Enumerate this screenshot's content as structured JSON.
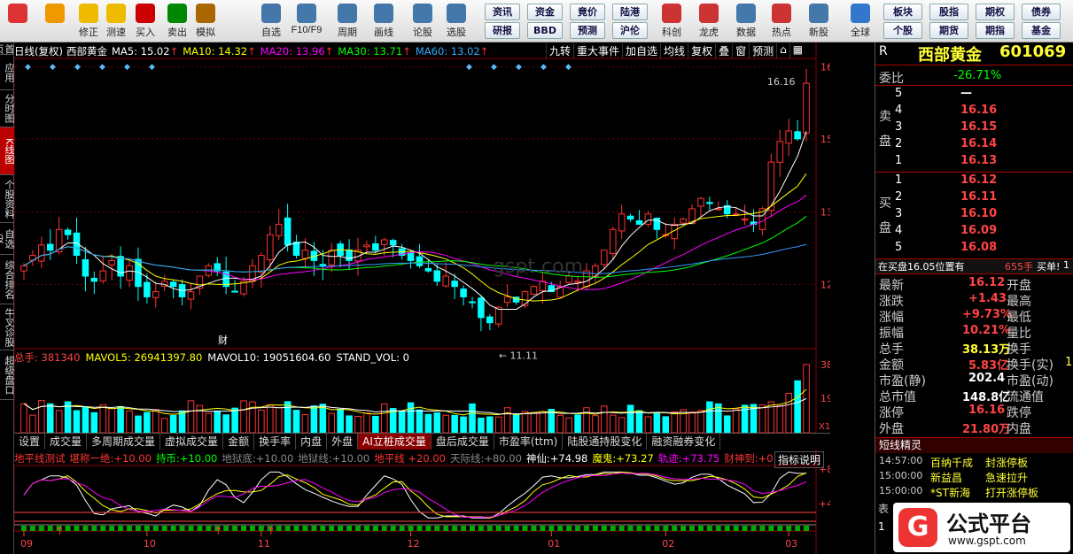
{
  "toolbar": {
    "left": [
      {
        "l": "",
        "c": "#d33"
      },
      {
        "l": "",
        "c": "#e90"
      },
      {
        "l": "修正",
        "c": "#eb0"
      },
      {
        "l": "测速",
        "c": "#eb0"
      },
      {
        "l": "买入",
        "c": "#c00"
      },
      {
        "l": "卖出",
        "c": "#080"
      },
      {
        "l": "模拟",
        "c": "#a60"
      },
      {
        "l": "自选",
        "c": "#47a"
      },
      {
        "l": "F10/F9",
        "c": "#47a"
      },
      {
        "l": "周期",
        "c": "#47a"
      },
      {
        "l": "画线",
        "c": "#47a"
      },
      {
        "l": "论股",
        "c": "#47a"
      },
      {
        "l": "选股",
        "c": "#47a"
      }
    ],
    "small": [
      [
        "资讯",
        "资金",
        "竟价",
        "陆港"
      ],
      [
        "研报",
        "BBD",
        "预测",
        "沪伦"
      ]
    ],
    "right": [
      {
        "l": "科创",
        "c": "#c33"
      },
      {
        "l": "龙虎",
        "c": "#c33"
      },
      {
        "l": "数据",
        "c": "#47a"
      },
      {
        "l": "热点",
        "c": "#c33"
      },
      {
        "l": "新股",
        "c": "#47a"
      },
      {
        "l": "全球",
        "c": "#37c"
      }
    ],
    "small2": [
      [
        "板块",
        "股指",
        "期权",
        "债券"
      ],
      [
        "个股",
        "期货",
        "期指",
        "基金"
      ]
    ]
  },
  "sidebar": [
    "首页",
    "应用",
    "分时图",
    "K线图",
    "个股资料",
    "自选股",
    "综合排名",
    "牛叉诊股",
    "超级盘口"
  ],
  "chart": {
    "period_label": "日线(复权)",
    "stock_name": "西部黄金",
    "ma": [
      {
        "k": "MA5",
        "v": "15.02",
        "c": "#fff"
      },
      {
        "k": "MA10",
        "v": "14.32",
        "c": "#ff0"
      },
      {
        "k": "MA20",
        "v": "13.96",
        "c": "#f0f"
      },
      {
        "k": "MA30",
        "v": "13.71",
        "c": "#0f0"
      },
      {
        "k": "MA60",
        "v": "13.02",
        "c": "#3af"
      }
    ],
    "buttons": [
      "九转",
      "重大事件",
      "加自选",
      "均线",
      "复权",
      "叠",
      "窗",
      "预测"
    ],
    "price_ticks": [
      "16.44",
      "15.05",
      "13.64",
      "12.24"
    ],
    "high_label": "16.16",
    "low_label": "11.11",
    "cai_label": "财",
    "vol_line": [
      {
        "k": "总手",
        "v": "381340",
        "c": "#f44"
      },
      {
        "k": "MAVOL5",
        "v": "26941397.80",
        "c": "#ff0"
      },
      {
        "k": "MAVOL10",
        "v": "19051604.60",
        "c": "#fff"
      },
      {
        "k": "STAND_VOL",
        "v": "0",
        "c": "#fff"
      }
    ],
    "vol_ticks": [
      "38134",
      "19321"
    ],
    "vol_unit": "X10",
    "tabs": [
      "设置",
      "成交量",
      "多周期成交量",
      "虚拟成交量",
      "金额",
      "换手率",
      "内盘",
      "外盘",
      "AI立桩成交量",
      "盘后成交量",
      "市盈率(ttm)",
      "陆股通持股变化",
      "融资融券变化"
    ],
    "active_tab": "AI立桩成交量",
    "ind_line": [
      {
        "t": "地平线测试",
        "c": "#f33"
      },
      {
        "t": "堪称一绝:+10.00",
        "c": "#f33"
      },
      {
        "t": "持币:+10.00",
        "c": "#0f0"
      },
      {
        "t": "地狱底:+10.00",
        "c": "#888"
      },
      {
        "t": "地狱线:+10.00",
        "c": "#888"
      },
      {
        "t": "地平线 +20.00",
        "c": "#f33"
      },
      {
        "t": "天际线:+80.00",
        "c": "#888"
      },
      {
        "t": "神仙:+74.98",
        "c": "#fff"
      },
      {
        "t": "魔鬼:+73.27",
        "c": "#ff0"
      },
      {
        "t": "轨迹:+73.75",
        "c": "#f0f"
      },
      {
        "t": "财神到:+0",
        "c": "#f33"
      }
    ],
    "ind_btn": "指标说明",
    "ind_ticks": [
      "+80.00",
      "+40.55"
    ],
    "months": [
      "09",
      "10",
      "11",
      "12",
      "01",
      "02",
      "03"
    ],
    "colors": {
      "up": "#ff3232",
      "down": "#00ffff",
      "ma5": "#ffffff",
      "ma10": "#ffff00",
      "ma20": "#ff00ff",
      "ma30": "#00ff00",
      "ma60": "#3399ff"
    }
  },
  "chart_data": {
    "type": "candlestick",
    "series": "西部黄金 日线(复权)",
    "ohlc_close": [
      12.6,
      12.8,
      13.0,
      12.9,
      13.3,
      13.2,
      12.8,
      12.4,
      12.3,
      12.5,
      12.7,
      12.4,
      12.6,
      12.2,
      12.0,
      12.1,
      12.3,
      12.2,
      12.0,
      12.1,
      12.4,
      12.6,
      12.5,
      12.2,
      12.1,
      12.3,
      12.6,
      12.8,
      13.2,
      13.4,
      13.0,
      12.8,
      12.9,
      12.7,
      12.6,
      12.9,
      12.8,
      12.7,
      12.9,
      13.0,
      12.9,
      13.1,
      13.0,
      12.8,
      12.7,
      12.6,
      12.5,
      12.3,
      12.4,
      12.2,
      12.0,
      11.9,
      11.6,
      11.5,
      11.8,
      12.0,
      11.9,
      12.1,
      12.2,
      12.3,
      12.1,
      12.2,
      12.4,
      12.3,
      12.5,
      12.6,
      12.9,
      13.3,
      13.6,
      13.5,
      13.4,
      13.6,
      13.3,
      13.2,
      13.4,
      13.5,
      13.7,
      13.9,
      13.8,
      13.7,
      13.6,
      13.6,
      13.5,
      13.4,
      13.7,
      14.6,
      15.0,
      15.2,
      15.05,
      16.12
    ],
    "high_label": 16.16,
    "low_label": 11.11,
    "vol_ticks": [
      38134,
      19321
    ],
    "price_ticks": [
      16.44,
      15.05,
      13.64,
      12.24
    ]
  },
  "rpanel": {
    "tag": "R",
    "name": "西部黄金",
    "code": "601069",
    "weibi_label": "委比",
    "weibi": "-26.71%",
    "sell_label": "卖盘",
    "buy_label": "买盘",
    "sell": [
      {
        "n": "5",
        "p": "—"
      },
      {
        "n": "4",
        "p": "16.16"
      },
      {
        "n": "3",
        "p": "16.15"
      },
      {
        "n": "2",
        "p": "16.14"
      },
      {
        "n": "1",
        "p": "16.13"
      }
    ],
    "buy": [
      {
        "n": "1",
        "p": "16.12"
      },
      {
        "n": "2",
        "p": "16.11"
      },
      {
        "n": "3",
        "p": "16.10"
      },
      {
        "n": "4",
        "p": "16.09"
      },
      {
        "n": "5",
        "p": "16.08"
      }
    ],
    "notice": "在买盘16.05位置有",
    "notice_qty": "655手",
    "notice_act": "买单!",
    "stats": [
      [
        "最新",
        "16.12",
        "开盘"
      ],
      [
        "涨跌",
        "+1.43",
        "最高"
      ],
      [
        "涨幅",
        "+9.73%",
        "最低"
      ],
      [
        "振幅",
        "10.21%",
        "量比"
      ],
      [
        "总手",
        "38.13万",
        "换手"
      ],
      [
        "金额",
        "5.83亿",
        "换手(实)"
      ],
      [
        "市盈(静)",
        "202.4",
        "市盈(动)"
      ],
      [
        "总市值",
        "148.8亿",
        "流通值"
      ],
      [
        "涨停",
        "16.16",
        "跌停"
      ],
      [
        "外盘",
        "21.80万",
        "内盘"
      ]
    ],
    "stats_extra": "1",
    "news_title": "短线精灵",
    "news": [
      [
        "14:57:00",
        "百纳千成",
        "封涨停板"
      ],
      [
        "15:00:00",
        "新益昌",
        "急速拉升"
      ],
      [
        "15:00:00",
        "*ST新海",
        "打开涨停板"
      ]
    ],
    "brand": "公式平台",
    "brand_url": "www.gspt.com",
    "brand_letter": "G",
    "watermark": "gspt.com",
    "misc": [
      "表",
      "1"
    ]
  }
}
